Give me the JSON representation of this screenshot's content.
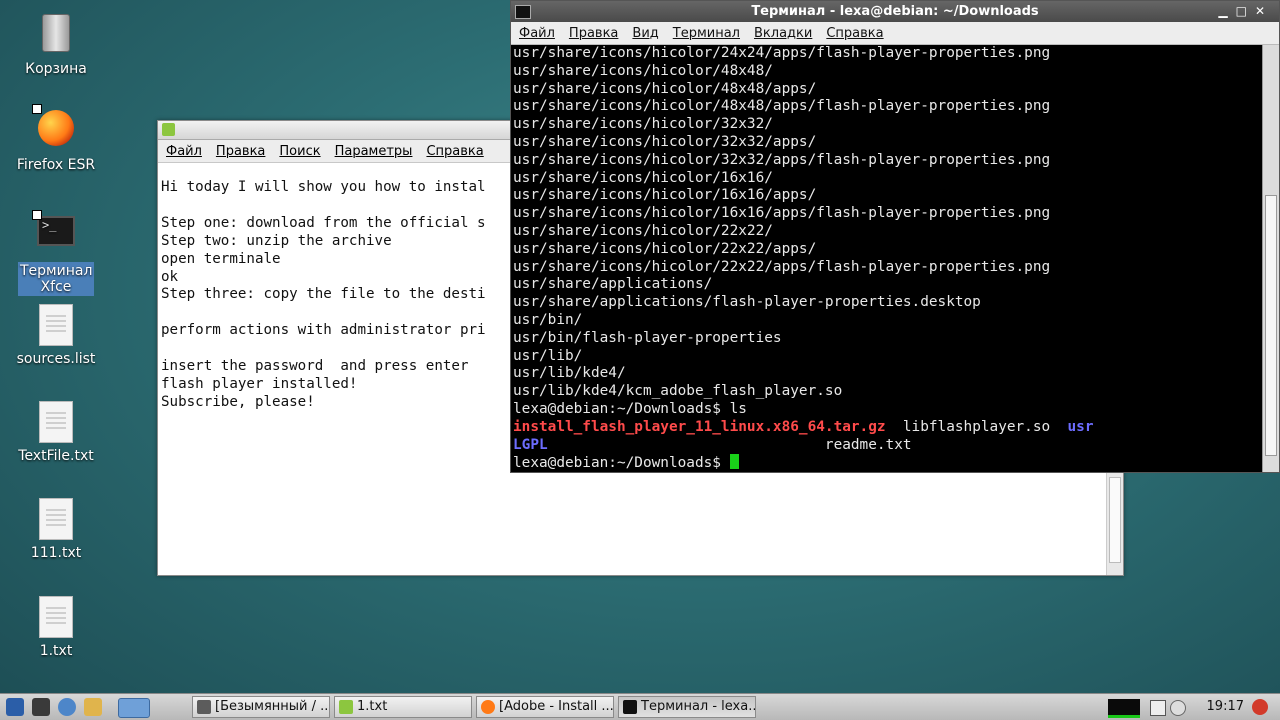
{
  "desktop": {
    "icons": [
      {
        "label": "Корзина"
      },
      {
        "label": "Firefox ESR"
      },
      {
        "label": "Терминал Xfce"
      },
      {
        "label": "sources.list"
      },
      {
        "label": "TextFile.txt"
      },
      {
        "label": "111.txt"
      },
      {
        "label": "1.txt"
      }
    ]
  },
  "editor": {
    "menu": [
      "Файл",
      "Правка",
      "Поиск",
      "Параметры",
      "Справка"
    ],
    "lines": [
      "Hi today I will show you how to instal",
      "",
      "Step one: download from the official s",
      "Step two: unzip the archive",
      "open terminale",
      "ok",
      "Step three: copy the file to the desti",
      "",
      "perform actions with administrator pri",
      "",
      "insert the password  and press enter",
      "flash player installed!",
      "Subscribe, please!"
    ]
  },
  "terminal": {
    "title": "Терминал - lexa@debian: ~/Downloads",
    "menu": [
      "Файл",
      "Правка",
      "Вид",
      "Терминал",
      "Вкладки",
      "Справка"
    ],
    "lines": [
      "usr/share/icons/hicolor/24x24/apps/flash-player-properties.png",
      "usr/share/icons/hicolor/48x48/",
      "usr/share/icons/hicolor/48x48/apps/",
      "usr/share/icons/hicolor/48x48/apps/flash-player-properties.png",
      "usr/share/icons/hicolor/32x32/",
      "usr/share/icons/hicolor/32x32/apps/",
      "usr/share/icons/hicolor/32x32/apps/flash-player-properties.png",
      "usr/share/icons/hicolor/16x16/",
      "usr/share/icons/hicolor/16x16/apps/",
      "usr/share/icons/hicolor/16x16/apps/flash-player-properties.png",
      "usr/share/icons/hicolor/22x22/",
      "usr/share/icons/hicolor/22x22/apps/",
      "usr/share/icons/hicolor/22x22/apps/flash-player-properties.png",
      "usr/share/applications/",
      "usr/share/applications/flash-player-properties.desktop",
      "usr/bin/",
      "usr/bin/flash-player-properties",
      "usr/lib/",
      "usr/lib/kde4/",
      "usr/lib/kde4/kcm_adobe_flash_player.so",
      "lexa@debian:~/Downloads$ ls"
    ],
    "ls_red": "install_flash_player_11_linux.x86_64.tar.gz",
    "ls_plain1": "  libflashplayer.so  ",
    "ls_blue1": "usr",
    "ls_blue2": "LGPL",
    "ls_plain2": "readme.txt",
    "prompt": "lexa@debian:~/Downloads$ "
  },
  "taskbar": {
    "tasks": [
      "[Безымянный / ...",
      "1.txt",
      "[Adobe - Install ...",
      "Терминал - lexa..."
    ],
    "clock": "19:17"
  }
}
